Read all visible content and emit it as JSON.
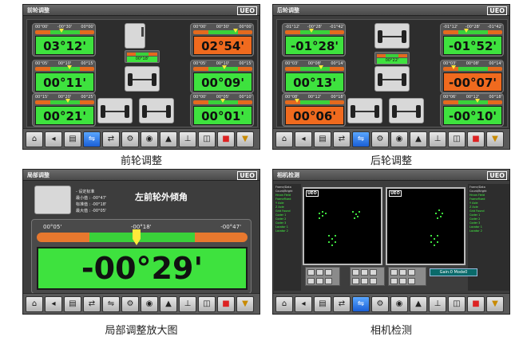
{
  "captions": [
    "前轮调整",
    "后轮调整",
    "局部调整放大图",
    "相机检测"
  ],
  "logo": "UEO",
  "front": {
    "title": "前轮调整",
    "tl": {
      "ticks": [
        "00°00'",
        "-00°30'",
        "00°00'"
      ],
      "value": "03°12'",
      "color": "green"
    },
    "tr": {
      "ticks": [
        "00°00'",
        "00°30'",
        "00°00'"
      ],
      "value": "02°54'",
      "color": "orange"
    },
    "ml": {
      "ticks": [
        "00°05'",
        "00°10'",
        "00°15'"
      ],
      "value": "00°11'",
      "color": "green"
    },
    "mr": {
      "ticks": [
        "00°05'",
        "00°10'",
        "00°15'"
      ],
      "value": "00°09'",
      "color": "green"
    },
    "bl": {
      "ticks": [
        "00°15'",
        "00°20'",
        "00°25'"
      ],
      "value": "00°21'",
      "color": "green"
    },
    "br": {
      "ticks": [
        "00°00'",
        "00°05'",
        "00°10'"
      ],
      "value": "00°01'",
      "color": "green"
    },
    "center": "00°18'"
  },
  "rear": {
    "title": "后轮调整",
    "tl": {
      "ticks": [
        "-01°12'",
        "-00°28'",
        "-01°42'"
      ],
      "value": "-01°28'",
      "color": "green"
    },
    "tr": {
      "ticks": [
        "-01°12'",
        "-00°28'",
        "-01°42'"
      ],
      "value": "-01°52'",
      "color": "green"
    },
    "ml": {
      "ticks": [
        "00°03'",
        "00°08'",
        "00°14'"
      ],
      "value": "00°13'",
      "color": "green"
    },
    "mr": {
      "ticks": [
        "00°03'",
        "00°08'",
        "00°14'"
      ],
      "value": "-00°07'",
      "color": "orange"
    },
    "bl": {
      "ticks": [
        "00°08'",
        "00°12'",
        "00°18'"
      ],
      "value": "00°06'",
      "color": "orange"
    },
    "br": {
      "ticks": [
        "00°06'",
        "00°12'",
        "00°18'"
      ],
      "value": "-00°10'",
      "color": "green"
    },
    "center": "00°22'"
  },
  "zoom": {
    "title": "局部调整",
    "heading": "左前轮外倾角",
    "info": [
      "- 设定标准",
      "最小值 : -00°47'",
      "标准值 : -00°18'",
      "最大值 : -00°05'"
    ],
    "ticks": [
      "00°05'",
      "-00°18'",
      "-00°47'"
    ],
    "value": "-00°29'"
  },
  "camera": {
    "title": "相机检测",
    "gain_label": "Gain:0  Mode0",
    "side_lines": [
      "Frame/Data   ",
      "Count/Bright  ",
      "Hrcon Field",
      "FrameFixed",
      "Y Axle",
      "Z Axle",
      "Grid Found",
      "Coder 1",
      "Coder 2",
      "Coder 3",
      "Locator 1",
      "Locator 2"
    ]
  },
  "toolbar_icons": [
    "home-icon",
    "back-icon",
    "print-icon",
    "car-icon",
    "swap-icon",
    "tool-icon",
    "wheel-icon",
    "lift-icon",
    "adjust-icon",
    "car-side-icon",
    "stop-icon",
    "ok-icon"
  ]
}
